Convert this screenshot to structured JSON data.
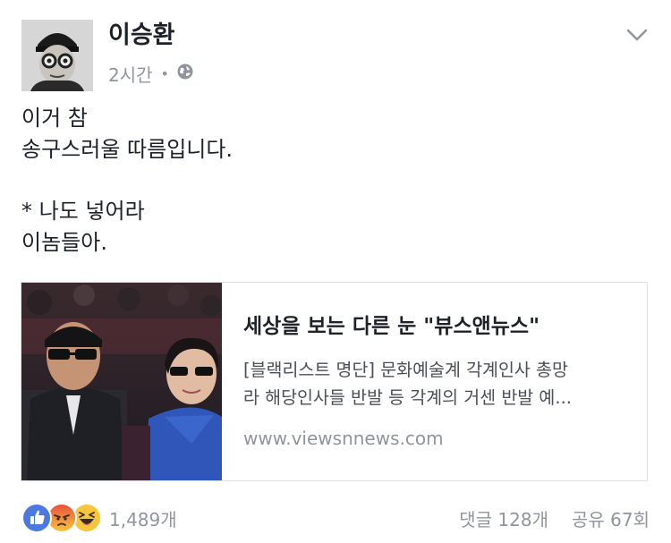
{
  "post": {
    "author": "이승환",
    "time": "2시간",
    "meta_dot": "•",
    "privacy_icon": "globe-icon",
    "menu_icon": "chevron-down-icon",
    "text_lines": [
      "이거 참",
      "송구스러울 따름입니다.",
      "",
      "* 나도 넣어라",
      "이놈들아."
    ]
  },
  "link": {
    "title": "세상을 보는 다른 눈 \"뷰스앤뉴스\"",
    "desc_lines": [
      "[블랙리스트 명단] 문화예술계 각계인사 총망",
      "라 해당인사들 반발 등 각계의 거센 반발 예..."
    ],
    "domain": "www.viewsnnews.com"
  },
  "footer": {
    "reaction_icons": [
      "like-icon",
      "angry-icon",
      "haha-icon"
    ],
    "reaction_count": "1,489개",
    "comments": "댓글 128개",
    "shares": "공유 67회"
  },
  "colors": {
    "text": "#1d2129",
    "secondary": "#90949c",
    "like_blue": "#4c79e0",
    "border": "#dddfe2"
  }
}
